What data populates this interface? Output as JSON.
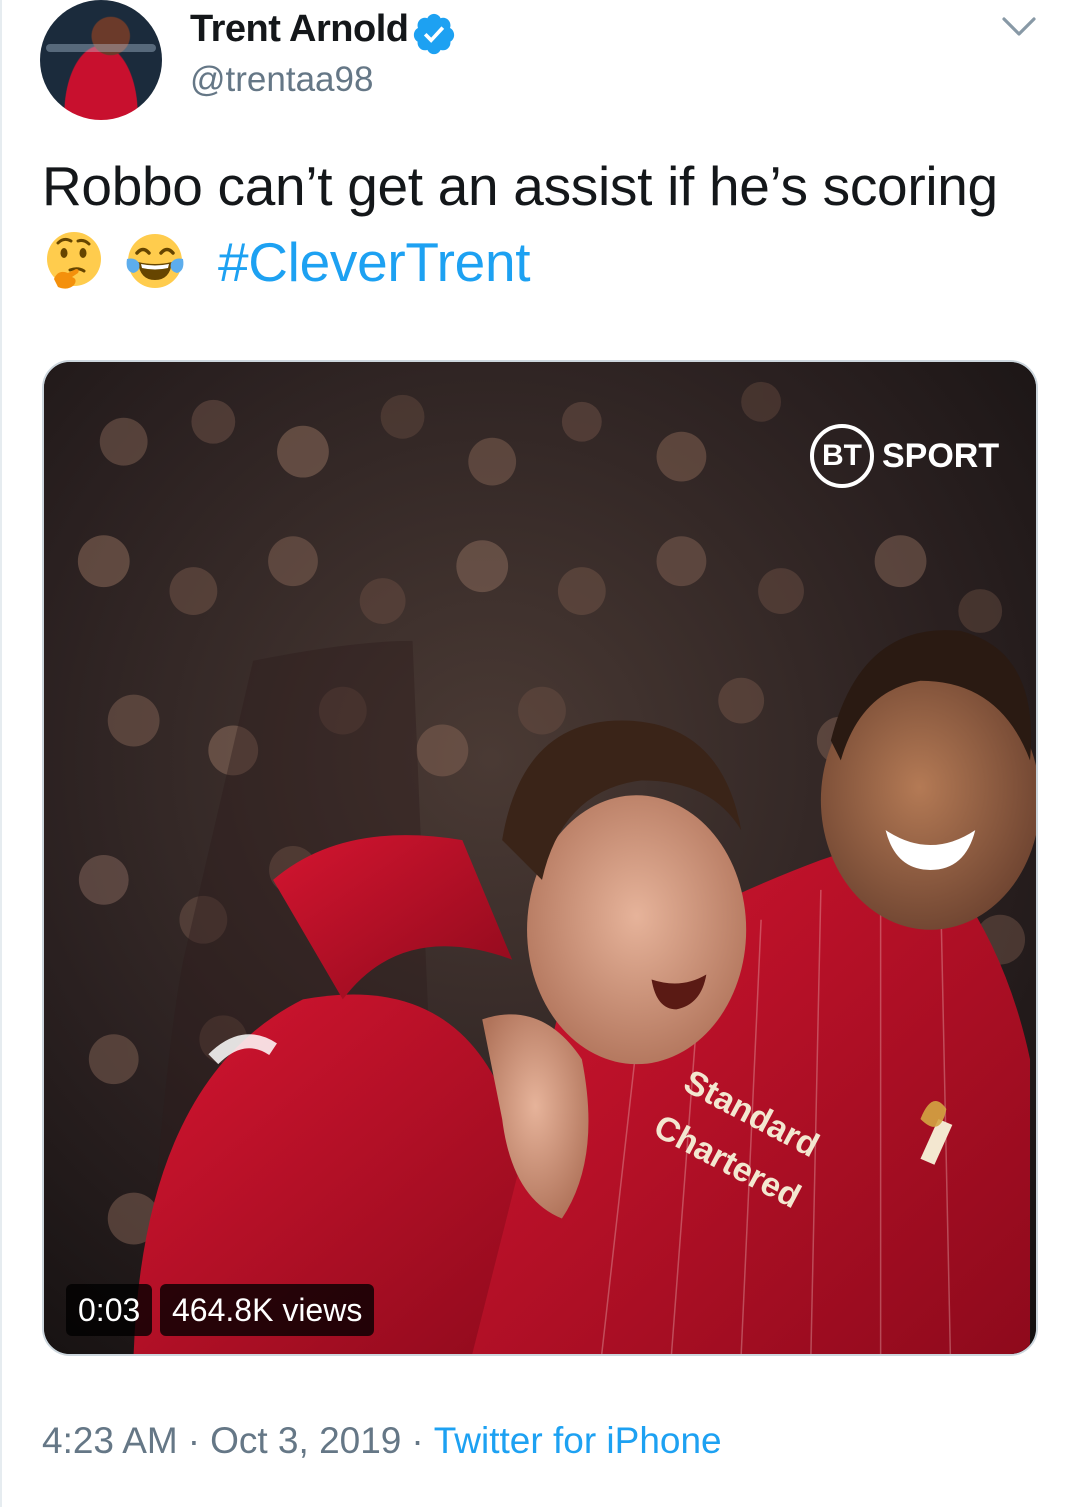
{
  "author": {
    "display_name": "Trent Arnold",
    "handle": "@trentaa98"
  },
  "icons": {
    "verified": "verified-badge-icon",
    "more": "chevron-down-icon",
    "emoji_1": "thinking-face",
    "emoji_2": "face-with-tears-of-joy"
  },
  "tweet": {
    "text": "Robbo can’t get an assist if he’s scoring",
    "hashtag": "#CleverTrent"
  },
  "media": {
    "broadcaster_circle": "BT",
    "broadcaster_text": "SPORT",
    "elapsed": "0:03",
    "views": "464.8K views"
  },
  "footer": {
    "time": "4:23 AM",
    "separator": "·",
    "date": "Oct 3, 2019",
    "source": "Twitter for iPhone"
  },
  "colors": {
    "link": "#1da1f2",
    "muted": "#657786",
    "text": "#14171a",
    "kit_red": "#c8102e"
  }
}
